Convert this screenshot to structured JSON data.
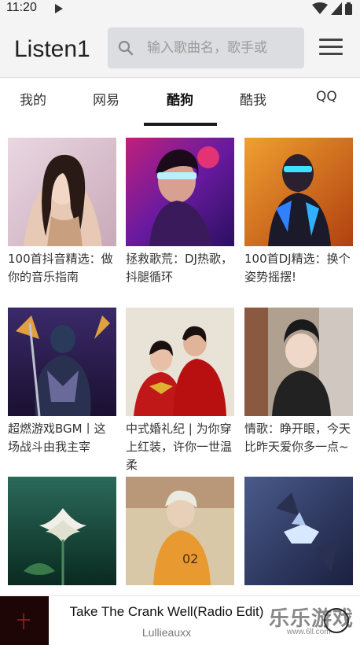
{
  "status_bar": {
    "time": "11:20"
  },
  "header": {
    "title": "Listen1",
    "search_placeholder": "输入歌曲名，歌手或"
  },
  "tabs": [
    {
      "label": "我的",
      "active": false
    },
    {
      "label": "网易",
      "active": false
    },
    {
      "label": "酷狗",
      "active": true
    },
    {
      "label": "酷我",
      "active": false
    },
    {
      "label": "QQ",
      "active": false
    }
  ],
  "playlists": [
    {
      "title": "100首抖音精选：做你的音乐指南"
    },
    {
      "title": "拯救歌荒：DJ热歌，抖腿循环"
    },
    {
      "title": "100首DJ精选：换个姿势摇摆!"
    },
    {
      "title": "超燃游戏BGM丨这场战斗由我主宰"
    },
    {
      "title": "中式婚礼纪 | 为你穿上红装，许你一世温柔"
    },
    {
      "title": "情歌：睁开眼，今天比昨天爱你多一点~"
    },
    {
      "title": ""
    },
    {
      "title": ""
    },
    {
      "title": ""
    }
  ],
  "player": {
    "title": "Take The Crank Well(Radio Edit)",
    "artist": "Lullieauxx"
  },
  "watermark": {
    "text": "乐乐游戏",
    "url": "www.6ll.com"
  },
  "colors": {
    "header_bg": "#f4f4f4",
    "search_bg": "#dcdde0",
    "tab_indicator": "#1a1a1a"
  }
}
